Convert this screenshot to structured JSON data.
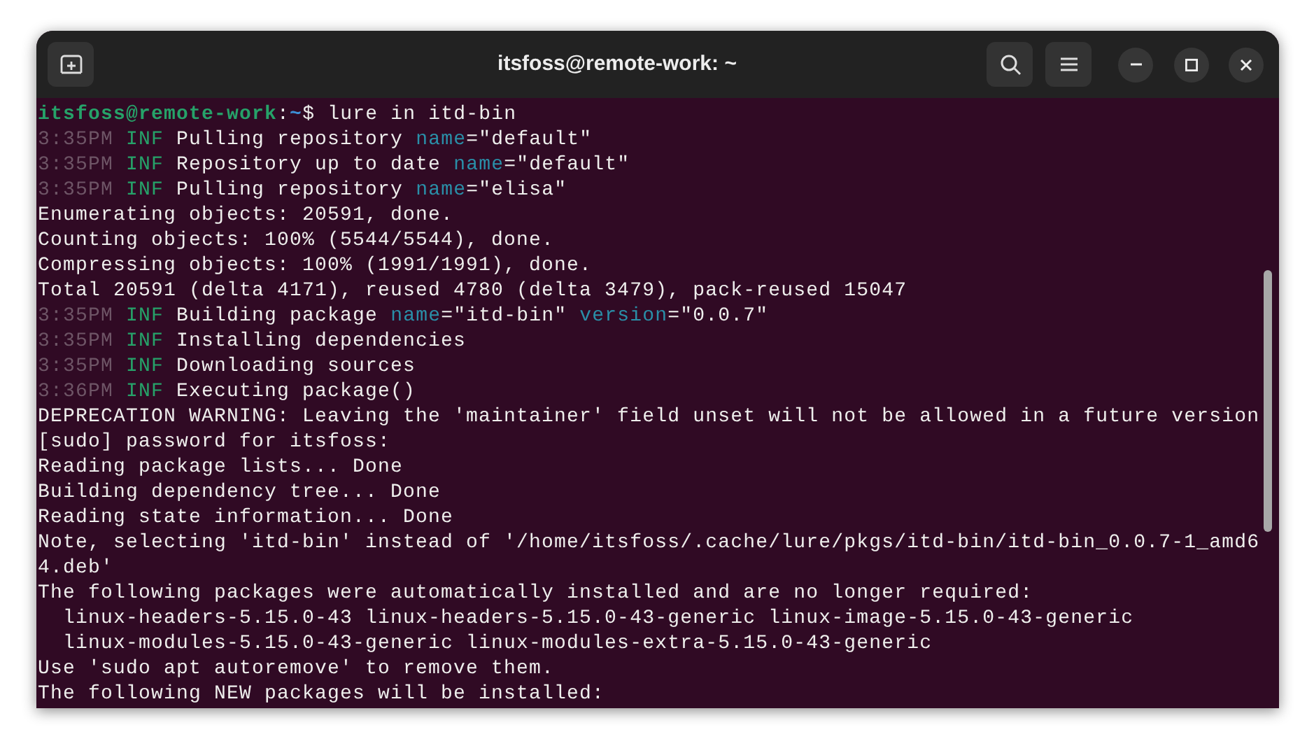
{
  "window": {
    "title": "itsfoss@remote-work: ~"
  },
  "terminal": {
    "lines": [
      [
        {
          "kind": "user",
          "text": "itsfoss@remote-work"
        },
        {
          "kind": "text",
          "text": ":"
        },
        {
          "kind": "path",
          "text": "~"
        },
        {
          "kind": "text",
          "text": "$ lure in itd-bin"
        }
      ],
      [
        {
          "kind": "time",
          "text": "3:35PM "
        },
        {
          "kind": "level",
          "text": "INF"
        },
        {
          "kind": "text",
          "text": " Pulling repository "
        },
        {
          "kind": "key",
          "text": "name"
        },
        {
          "kind": "text",
          "text": "=\"default\""
        }
      ],
      [
        {
          "kind": "time",
          "text": "3:35PM "
        },
        {
          "kind": "level",
          "text": "INF"
        },
        {
          "kind": "text",
          "text": " Repository up to date "
        },
        {
          "kind": "key",
          "text": "name"
        },
        {
          "kind": "text",
          "text": "=\"default\""
        }
      ],
      [
        {
          "kind": "time",
          "text": "3:35PM "
        },
        {
          "kind": "level",
          "text": "INF"
        },
        {
          "kind": "text",
          "text": " Pulling repository "
        },
        {
          "kind": "key",
          "text": "name"
        },
        {
          "kind": "text",
          "text": "=\"elisa\""
        }
      ],
      [
        {
          "kind": "text",
          "text": "Enumerating objects: 20591, done."
        }
      ],
      [
        {
          "kind": "text",
          "text": "Counting objects: 100% (5544/5544), done."
        }
      ],
      [
        {
          "kind": "text",
          "text": "Compressing objects: 100% (1991/1991), done."
        }
      ],
      [
        {
          "kind": "text",
          "text": "Total 20591 (delta 4171), reused 4780 (delta 3479), pack-reused 15047"
        }
      ],
      [
        {
          "kind": "time",
          "text": "3:35PM "
        },
        {
          "kind": "level",
          "text": "INF"
        },
        {
          "kind": "text",
          "text": " Building package "
        },
        {
          "kind": "key",
          "text": "name"
        },
        {
          "kind": "text",
          "text": "=\"itd-bin\" "
        },
        {
          "kind": "key",
          "text": "version"
        },
        {
          "kind": "text",
          "text": "=\"0.0.7\""
        }
      ],
      [
        {
          "kind": "time",
          "text": "3:35PM "
        },
        {
          "kind": "level",
          "text": "INF"
        },
        {
          "kind": "text",
          "text": " Installing dependencies"
        }
      ],
      [
        {
          "kind": "time",
          "text": "3:35PM "
        },
        {
          "kind": "level",
          "text": "INF"
        },
        {
          "kind": "text",
          "text": " Downloading sources"
        }
      ],
      [
        {
          "kind": "time",
          "text": "3:36PM "
        },
        {
          "kind": "level",
          "text": "INF"
        },
        {
          "kind": "text",
          "text": " Executing package()"
        }
      ],
      [
        {
          "kind": "text",
          "text": "DEPRECATION WARNING: Leaving the 'maintainer' field unset will not be allowed in a future version"
        }
      ],
      [
        {
          "kind": "text",
          "text": "[sudo] password for itsfoss:"
        }
      ],
      [
        {
          "kind": "text",
          "text": "Reading package lists... Done"
        }
      ],
      [
        {
          "kind": "text",
          "text": "Building dependency tree... Done"
        }
      ],
      [
        {
          "kind": "text",
          "text": "Reading state information... Done"
        }
      ],
      [
        {
          "kind": "text",
          "text": "Note, selecting 'itd-bin' instead of '/home/itsfoss/.cache/lure/pkgs/itd-bin/itd-bin_0.0.7-1_amd6"
        }
      ],
      [
        {
          "kind": "text",
          "text": "4.deb'"
        }
      ],
      [
        {
          "kind": "text",
          "text": "The following packages were automatically installed and are no longer required:"
        }
      ],
      [
        {
          "kind": "text",
          "text": "  linux-headers-5.15.0-43 linux-headers-5.15.0-43-generic linux-image-5.15.0-43-generic"
        }
      ],
      [
        {
          "kind": "text",
          "text": "  linux-modules-5.15.0-43-generic linux-modules-extra-5.15.0-43-generic"
        }
      ],
      [
        {
          "kind": "text",
          "text": "Use 'sudo apt autoremove' to remove them."
        }
      ],
      [
        {
          "kind": "text",
          "text": "The following NEW packages will be installed:"
        }
      ]
    ]
  }
}
